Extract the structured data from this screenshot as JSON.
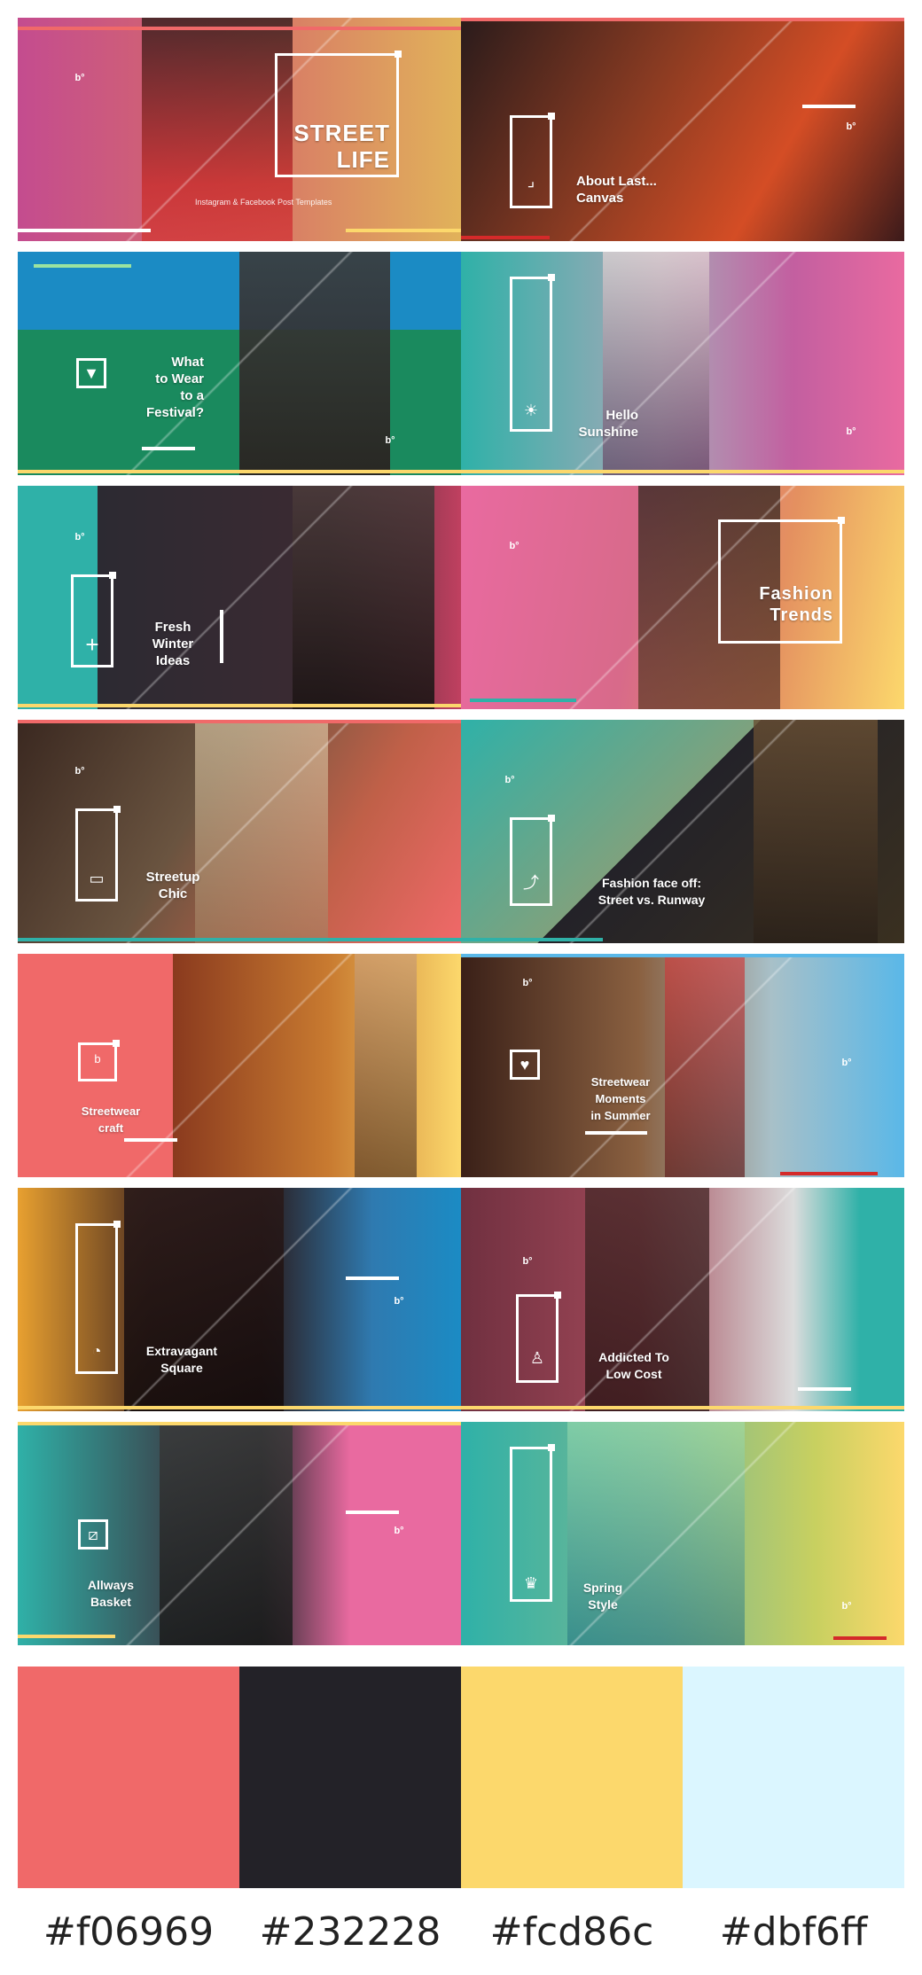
{
  "tiles": [
    {
      "caption": "STREET\nLIFE",
      "subtitle": "Instagram & Facebook Post Templates",
      "icon": "square-frame-icon",
      "glyph": ""
    },
    {
      "caption": "About Last...\nCanvas",
      "subtitle": "",
      "icon": "corner-arrow-icon",
      "glyph": "⌟"
    },
    {
      "caption": "What\nto Wear\nto a\nFestival?",
      "subtitle": "",
      "icon": "triangle-down-icon",
      "glyph": "▼"
    },
    {
      "caption": "Hello\nSunshine",
      "subtitle": "",
      "icon": "sun-icon",
      "glyph": "☀"
    },
    {
      "caption": "Fresh\nWinter\nIdeas",
      "subtitle": "",
      "icon": "plus-icon",
      "glyph": "+"
    },
    {
      "caption": "Fashion\nTrends",
      "subtitle": "",
      "icon": "square-frame-icon",
      "glyph": ""
    },
    {
      "caption": "Streetup\nChic",
      "subtitle": "",
      "icon": "mirror-icon",
      "glyph": "▭"
    },
    {
      "caption": "Fashion face off:\nStreet vs. Runway",
      "subtitle": "",
      "icon": "trend-icon",
      "glyph": "⤴"
    },
    {
      "caption": "Streetwear\ncraft",
      "subtitle": "",
      "icon": "frame-badge-icon",
      "glyph": "b"
    },
    {
      "caption": "Streetwear\nMoments\nin Summer",
      "subtitle": "",
      "icon": "heart-icon",
      "glyph": "♥"
    },
    {
      "caption": "Extravagant\nSquare",
      "subtitle": "",
      "icon": "leaf-icon",
      "glyph": "◔"
    },
    {
      "caption": "Addicted To\nLow Cost",
      "subtitle": "",
      "icon": "person-icon",
      "glyph": "♙"
    },
    {
      "caption": "Allways\nBasket",
      "subtitle": "",
      "icon": "slash-square-icon",
      "glyph": "⧄"
    },
    {
      "caption": "Spring\nStyle",
      "subtitle": "",
      "icon": "crown-icon",
      "glyph": "♛"
    }
  ],
  "palette": {
    "swatches": [
      {
        "hex": "#f06969",
        "label": "#f06969"
      },
      {
        "hex": "#232228",
        "label": "#232228"
      },
      {
        "hex": "#fcd86c",
        "label": "#fcd86c"
      },
      {
        "hex": "#dbf6ff",
        "label": "#dbf6ff"
      }
    ]
  },
  "accent": {
    "pink": "#e96aa0",
    "teal": "#2fb1a8",
    "blue": "#1b8bc4",
    "yellow": "#fcd86c",
    "dark": "#232228",
    "coral": "#f06969"
  }
}
